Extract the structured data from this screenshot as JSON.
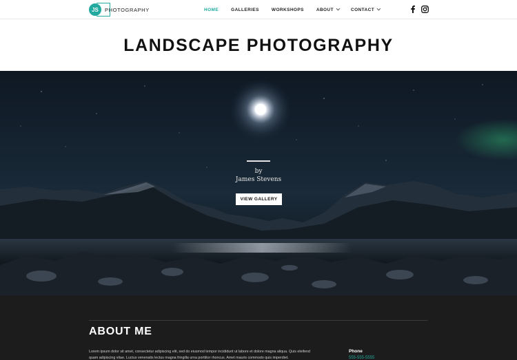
{
  "header": {
    "logo_initials": "JS",
    "logo_text": "PHOTOGRAPHY",
    "menu": [
      {
        "label": "HOME",
        "active": true,
        "dropdown": false
      },
      {
        "label": "GALLERIES",
        "active": false,
        "dropdown": false
      },
      {
        "label": "WORKSHOPS",
        "active": false,
        "dropdown": false
      },
      {
        "label": "ABOUT",
        "active": false,
        "dropdown": true
      },
      {
        "label": "CONTACT",
        "active": false,
        "dropdown": true
      }
    ],
    "social": [
      "facebook-icon",
      "instagram-icon"
    ]
  },
  "page": {
    "title": "LANDSCAPE PHOTOGRAPHY"
  },
  "hero": {
    "by": "by",
    "author": "James Stevens",
    "button_label": "VIEW GALLERY"
  },
  "about": {
    "title": "ABOUT ME",
    "text": "Lorem ipsum dolor sit amet, consectetur adipiscing elit, sed do eiusmod tempor incididunt ut labore et dolore magna aliqua. Quis eleifend quam adipiscing vitae. Luctus venenatis lectus magna fringilla urna porttitor rhoncus. Amet mauris commodo quis imperdiet.",
    "phone_label": "Phone",
    "phone_value": "555-555-5555"
  },
  "colors": {
    "accent": "#22a9a0",
    "dark": "#1c1c1c"
  }
}
